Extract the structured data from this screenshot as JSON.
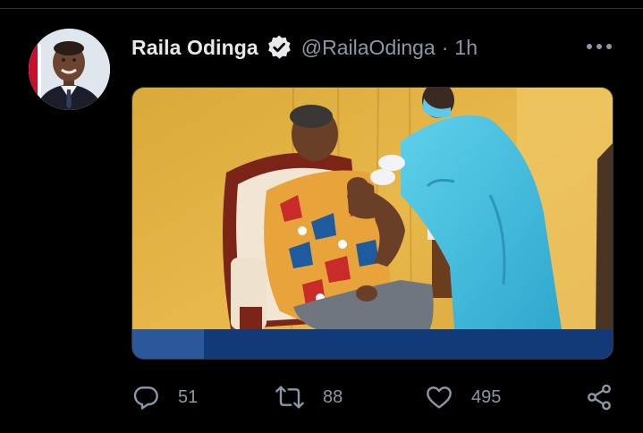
{
  "tweet": {
    "author": {
      "name": "Raila Odinga",
      "handle": "@RailaOdinga",
      "verified": true,
      "avatar_icon": "profile-photo"
    },
    "separator": "·",
    "time": "1h",
    "more_icon": "more-horizontal-icon",
    "media": {
      "kind": "photo",
      "description_icon": "photo"
    },
    "actions": {
      "replies": "51",
      "retweets": "88",
      "likes": "495",
      "reply_icon": "reply-icon",
      "retweet_icon": "retweet-icon",
      "like_icon": "heart-icon",
      "share_icon": "share-icon"
    }
  },
  "colors": {
    "background": "#000000",
    "primary_text": "#e7e9ea",
    "secondary_text": "#8b98a5",
    "divider": "#2f3336"
  }
}
